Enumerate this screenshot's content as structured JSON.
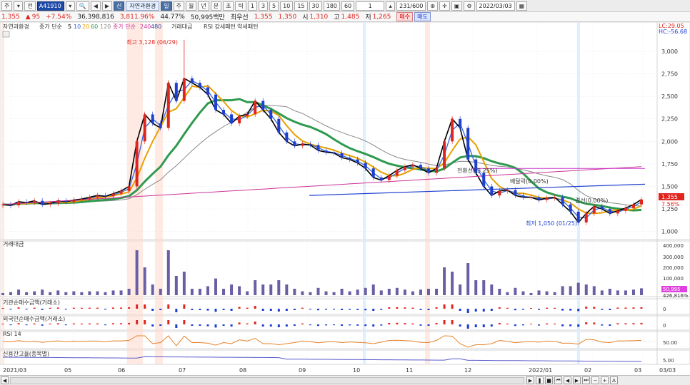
{
  "toolbar": {
    "mode": "주",
    "type": "전",
    "code": "A41910",
    "credit_badge": "신",
    "stock_name": "자연과환경",
    "period_buttons": [
      "일",
      "주",
      "월",
      "년",
      "분",
      "초",
      "틱"
    ],
    "interval_buttons": [
      "1",
      "3",
      "5",
      "10",
      "15",
      "30",
      "180",
      "60"
    ],
    "count_value": "1",
    "page_indicator": "231/600",
    "date": "2022/03/03"
  },
  "quote": {
    "price": "1,355",
    "change_arrow": "▲",
    "change": "95",
    "change_pct": "+7.54%",
    "volume": "36,398,816",
    "vol_ratio": "3,811.96%",
    "rate": "44.77%",
    "amount": "50,995백만",
    "best_ask_label": "최우선",
    "best_ask": "1,355",
    "best_bid": "1,350",
    "open_label": "시",
    "open": "1,310",
    "high_label": "고",
    "high": "1,485",
    "low_label": "저",
    "low": "1,265",
    "buy_label": "매수",
    "sell_label": "매도"
  },
  "price_panel": {
    "name": "자연과환경",
    "ma_label": "종가 단순",
    "ma_periods": [
      "5",
      "10",
      "20",
      "60",
      "120"
    ],
    "ma_colors": [
      "#000000",
      "#3366dd",
      "#e8a000",
      "#2f9a4f",
      "#888888"
    ],
    "vma_label": "종가 단순",
    "vma_periods": [
      "240",
      "480"
    ],
    "legend_extra": [
      "거래대금",
      "RSI 강세패턴",
      "약세패턴"
    ],
    "lc_label": "LC:29.05",
    "hc_label": "HC:-56.68",
    "y_ticks": [
      "3,000",
      "2,750",
      "2,500",
      "2,250",
      "2,000",
      "1,750",
      "1,500",
      "1,250",
      "1,000"
    ],
    "high_note": "최고 3,128 (06/29)",
    "low_note": "최저 1,050 (01/25)",
    "annotations": [
      "전환선(-3.25%)",
      "배달락(0.00%)",
      "결선(0.00%)"
    ],
    "current_price_tag": "1,355",
    "current_pct_tag": "7.56%"
  },
  "volume_panel": {
    "title": "거래대금",
    "y_ticks": [
      "400,000",
      "300,000",
      "200,000",
      "100,000"
    ],
    "last_value": "50,995",
    "sub_value": "426,816%"
  },
  "inst_panel": {
    "title": "기관순매수금액(거래소)",
    "tick": "0"
  },
  "foreign_panel": {
    "title": "외국인순매수금액(거래소)",
    "tick": "0"
  },
  "rsi_panel": {
    "title": "RSI 14",
    "tick": "50.00"
  },
  "credit_panel": {
    "title": "신용잔고율(종목별)",
    "tick": "5.00"
  },
  "x_axis": {
    "labels": [
      "2021/03",
      "05",
      "06",
      "07",
      "08",
      "09",
      "10",
      "11",
      "12",
      "2022/01",
      "02",
      "03",
      "03/03"
    ]
  },
  "chart_data": {
    "type": "candlestick",
    "title": "자연과환경",
    "y_range": [
      950,
      3150
    ],
    "all_time_high": 3128,
    "all_time_low": 1050,
    "last_close": 1355,
    "close_path": [
      1300,
      1290,
      1330,
      1320,
      1340,
      1300,
      1310,
      1340,
      1330,
      1350,
      1360,
      1380,
      1400,
      1390,
      1420,
      1450,
      1500,
      2000,
      2300,
      2200,
      2150,
      2650,
      2450,
      2700,
      2650,
      2600,
      2520,
      2350,
      2300,
      2200,
      2280,
      2300,
      2450,
      2350,
      2250,
      2100,
      2000,
      1950,
      1970,
      1960,
      1900,
      1880,
      1870,
      1820,
      1800,
      1760,
      1700,
      1600,
      1570,
      1620,
      1680,
      1720,
      1740,
      1700,
      1650,
      1700,
      2000,
      2250,
      2150,
      1800,
      1650,
      1500,
      1400,
      1450,
      1460,
      1400,
      1380,
      1380,
      1350,
      1370,
      1380,
      1300,
      1220,
      1100,
      1200,
      1280,
      1250,
      1200,
      1230,
      1260,
      1300,
      1355
    ]
  }
}
